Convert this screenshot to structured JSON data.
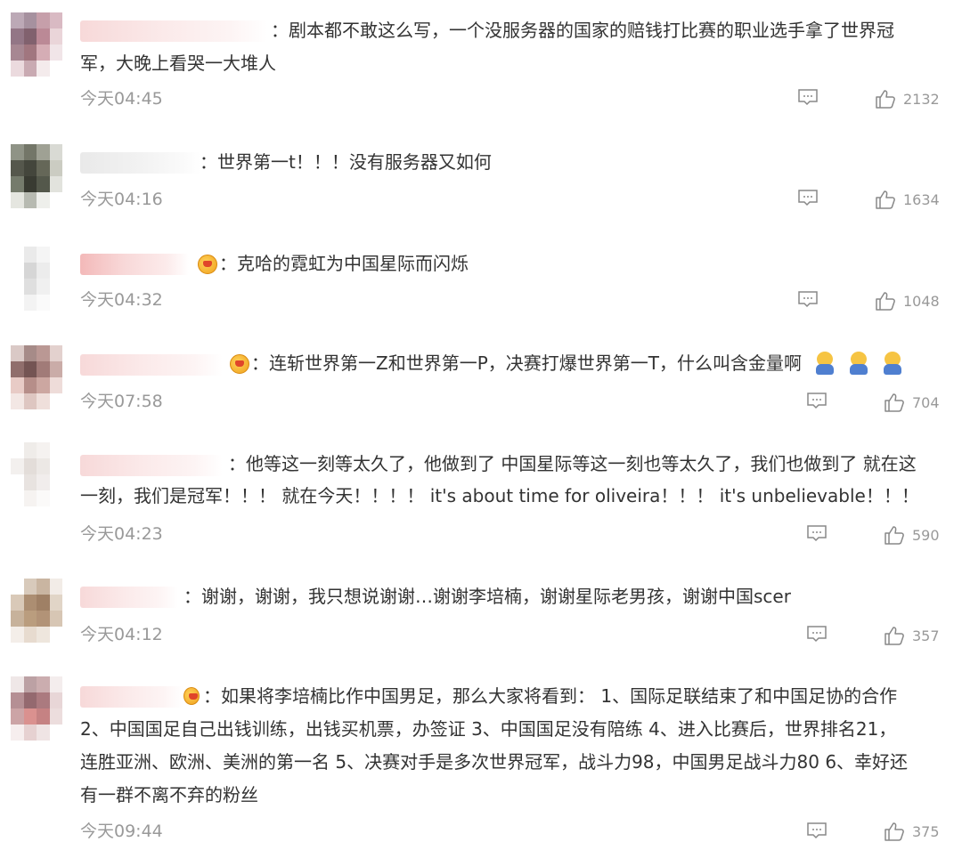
{
  "comments": [
    {
      "lines": [
        "：剧本都不敢这么写，一个没服务器的国家的赔钱打比赛的职业选手拿了世界冠",
        "军，大晚上看哭一大堆人"
      ],
      "time": "今天04:45",
      "likes": "2132"
    },
    {
      "lines": [
        "：世界第一t！！！没有服务器又如何"
      ],
      "time": "今天04:16",
      "likes": "1634"
    },
    {
      "lines": [
        "：克哈的霓虹为中国星际而闪烁"
      ],
      "time": "今天04:32",
      "likes": "1048"
    },
    {
      "lines": [
        "：连斩世界第一Z和世界第一P，决赛打爆世界第一T，什么叫含金量啊"
      ],
      "time": "今天07:58",
      "likes": "704"
    },
    {
      "lines": [
        "：他等这一刻等太久了，他做到了 中国星际等这一刻也等太久了，我们也做到了 就在这",
        "一刻，我们是冠军！！！ 就在今天！！！！ it's about time for oliveira！！！ it's unbelievable！！！"
      ],
      "time": "今天04:23",
      "likes": "590"
    },
    {
      "lines": [
        "：谢谢，谢谢，我只想说谢谢…谢谢李培楠，谢谢星际老男孩，谢谢中国scer"
      ],
      "time": "今天04:12",
      "likes": "357"
    },
    {
      "lines": [
        "：如果将李培楠比作中国男足，那么大家将看到： 1、国际足联结束了和中国足协的合作",
        "2、中国国足自己出钱训练，出钱买机票，办签证 3、中国国足没有陪练 4、进入比赛后，世界排名21，",
        "连胜亚洲、欧洲、美洲的第一名 5、决赛对手是多次世界冠军，战斗力98，中国男足战斗力80 6、幸好还",
        "有一群不离不弃的粉丝"
      ],
      "time": "今天09:44",
      "likes": "375"
    }
  ],
  "icons": {
    "reply": "reply-icon",
    "like": "thumbs-up-icon",
    "badge": "crown-badge-icon",
    "emoji": "crying-emoji-icon"
  },
  "colors": {
    "text": "#333333",
    "meta": "#999999"
  }
}
